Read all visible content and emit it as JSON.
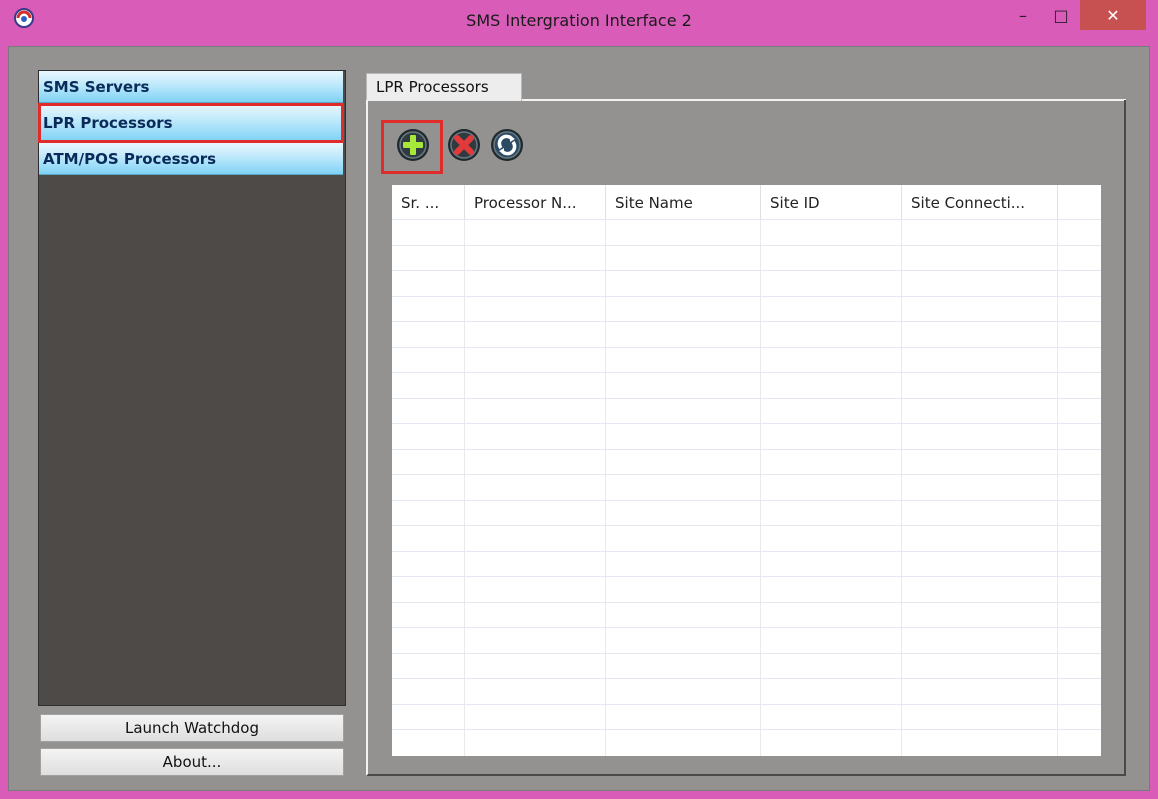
{
  "window": {
    "title": "SMS Intergration Interface 2",
    "minimize_glyph": "–",
    "maximize_glyph": "□",
    "close_glyph": "✕",
    "app_icon": "app-logo-icon"
  },
  "sidebar": {
    "items": [
      {
        "label": "SMS Servers",
        "selected": false
      },
      {
        "label": "LPR Processors",
        "selected": true
      },
      {
        "label": "ATM/POS Processors",
        "selected": false
      }
    ],
    "launch_watchdog_label": "Launch Watchdog",
    "about_label": "About..."
  },
  "tabs": [
    {
      "label": "LPR Processors",
      "active": true
    }
  ],
  "toolbar": {
    "add_icon": "add-icon",
    "remove_icon": "remove-icon",
    "refresh_icon": "refresh-icon"
  },
  "table": {
    "columns": [
      "Sr. ...",
      "Processor N...",
      "Site Name",
      "Site ID",
      "Site Connecti..."
    ],
    "rows": []
  },
  "colors": {
    "accent_frame": "#d85cb8",
    "selection_outline": "#e02b2b",
    "sidebar_item_top": "#eaf7ff",
    "sidebar_item_bottom": "#7fd2f5"
  }
}
